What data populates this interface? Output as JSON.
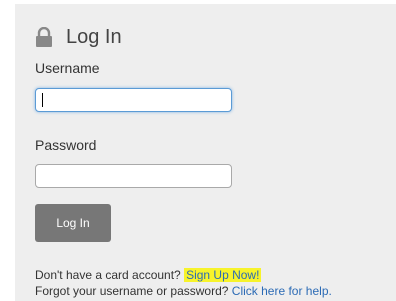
{
  "form": {
    "title": "Log In",
    "lock_icon": "lock-icon",
    "username_label": "Username",
    "username_value": "",
    "password_label": "Password",
    "password_value": "",
    "login_button": "Log In"
  },
  "footer": {
    "no_account_text": "Don't have a card account?",
    "signup_link": "Sign Up Now!",
    "forgot_text": "Forgot your username or password?",
    "help_link": "Click here for help."
  },
  "colors": {
    "panel_bg": "#eeeeee",
    "button_bg": "#777777",
    "link": "#2c6bb5",
    "highlight": "#f7f32b"
  }
}
